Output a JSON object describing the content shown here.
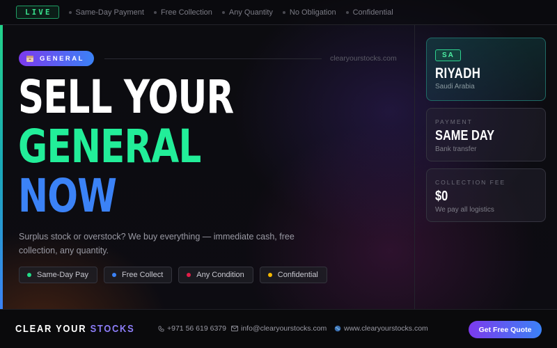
{
  "topbar": {
    "live_label": "LIVE",
    "items": [
      "Same-Day Payment",
      "Free Collection",
      "Any Quantity",
      "No Obligation",
      "Confidential"
    ]
  },
  "hero": {
    "badge_label": "GENERAL",
    "site": "clearyourstocks.com",
    "headline": [
      "SELL YOUR",
      "GENERAL",
      "NOW"
    ],
    "description": "Surplus stock or overstock? We buy everything — immediate cash, free collection, any quantity.",
    "chips": [
      {
        "label": "Same-Day Pay",
        "color": "#22dd88"
      },
      {
        "label": "Free Collect",
        "color": "#3b82f6"
      },
      {
        "label": "Any Condition",
        "color": "#e11d48"
      },
      {
        "label": "Confidential",
        "color": "#f5b800"
      }
    ]
  },
  "cards": {
    "location": {
      "code": "SA",
      "city": "RIYADH",
      "country": "Saudi Arabia"
    },
    "payment": {
      "label": "PAYMENT",
      "value": "SAME DAY",
      "sub": "Bank transfer"
    },
    "fee": {
      "label": "COLLECTION FEE",
      "value": "$0",
      "sub": "We pay all logistics"
    }
  },
  "footer": {
    "brand_part1": "CLEAR YOUR",
    "brand_part2": "STOCKS",
    "phone": "+971 56 619 6379",
    "email": "info@clearyourstocks.com",
    "website": "www.clearyourstocks.com",
    "cta": "Get Free Quote"
  },
  "colors": {
    "green": "#22ee99",
    "blue": "#3b82f6",
    "purple": "#7c3aed"
  }
}
